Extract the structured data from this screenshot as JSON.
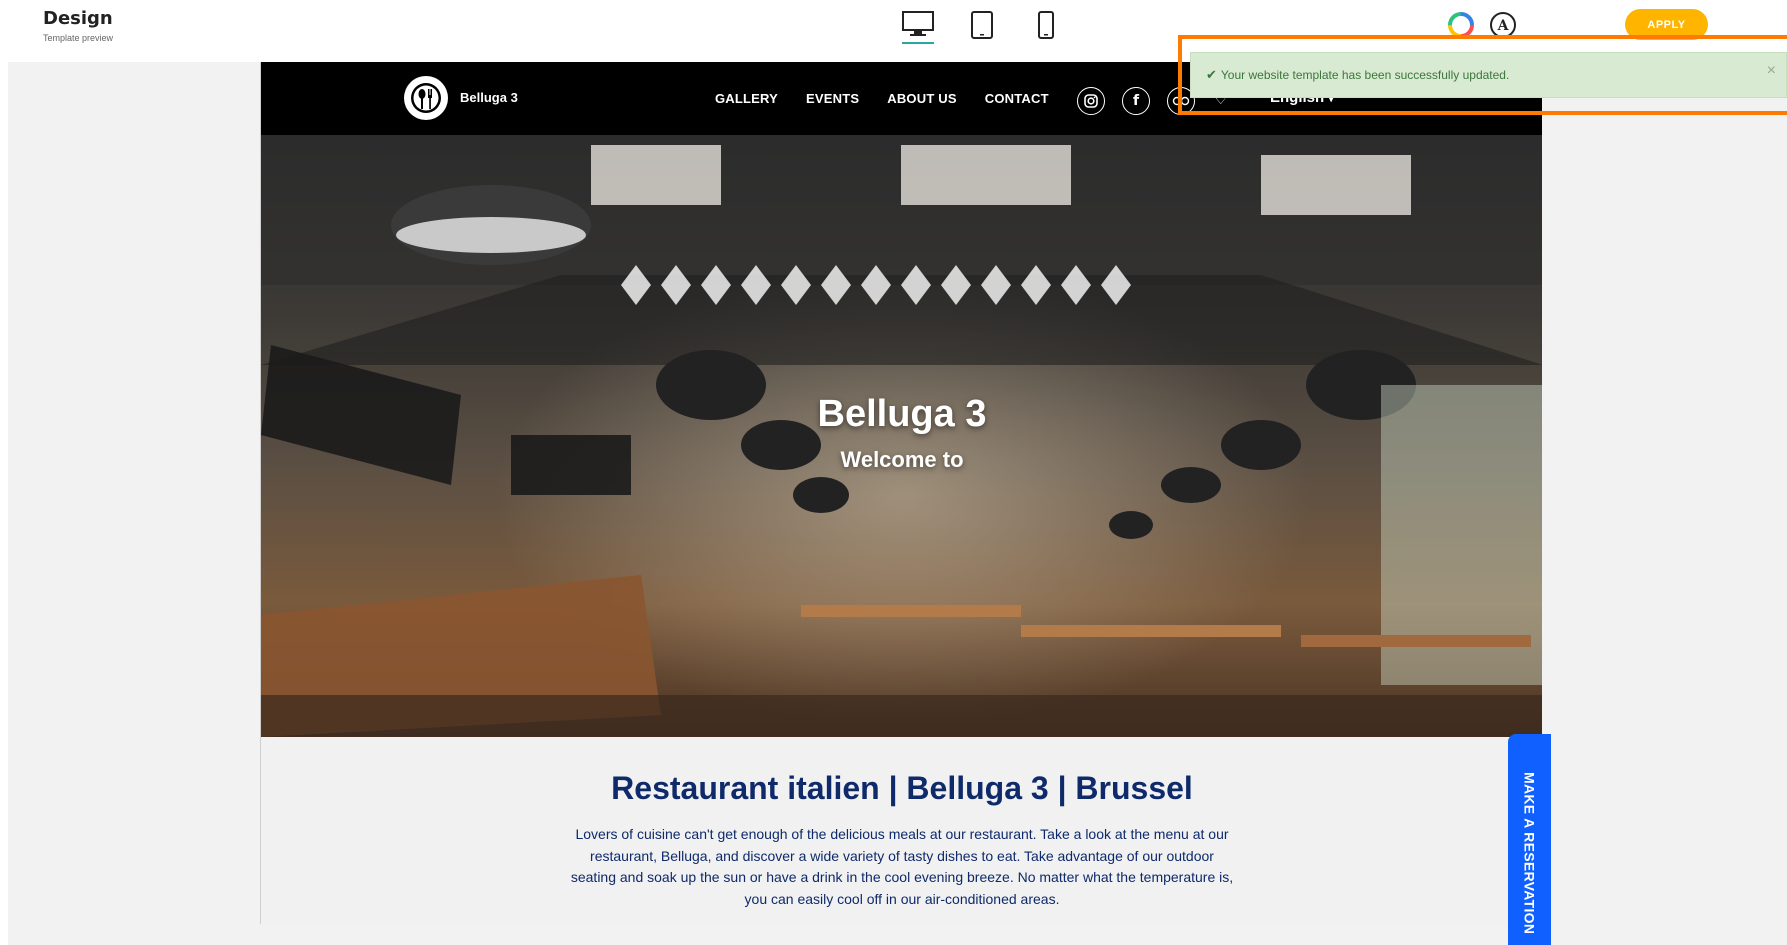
{
  "app": {
    "title": "Design",
    "subtitle": "Template preview",
    "apply_label": "APPLY",
    "devices": [
      {
        "name": "desktop",
        "active": true
      },
      {
        "name": "tablet",
        "active": false
      },
      {
        "name": "mobile",
        "active": false
      }
    ]
  },
  "site": {
    "name": "Belluga 3",
    "nav": [
      "GALLERY",
      "EVENTS",
      "ABOUT US",
      "CONTACT"
    ],
    "language": "English",
    "hero_title": "Belluga 3",
    "hero_subtitle": "Welcome to",
    "content_title": "Restaurant italien | Belluga 3 | Brussel",
    "content_text": "Lovers of cuisine can't get enough of the delicious meals at our restaurant. Take a look at the menu at our restaurant, Belluga, and discover a wide variety of tasty dishes to eat. Take advantage of our outdoor seating and soak up the sun or have a drink in the cool evening breeze. No matter what the temperature is, you can easily cool off in our air-conditioned areas.",
    "reserve_label": "MAKE A RESERVATION",
    "socials": [
      "instagram-icon",
      "facebook-icon",
      "tripadvisor-icon"
    ]
  },
  "toast": {
    "message": "Your website template has been successfully updated.",
    "close": "×"
  },
  "colors": {
    "accent": "#ffb400",
    "highlight": "#ff7a00",
    "site_blue": "#0e2a6b",
    "reserve_blue": "#1060ff",
    "toast_bg": "#d8ead2"
  }
}
